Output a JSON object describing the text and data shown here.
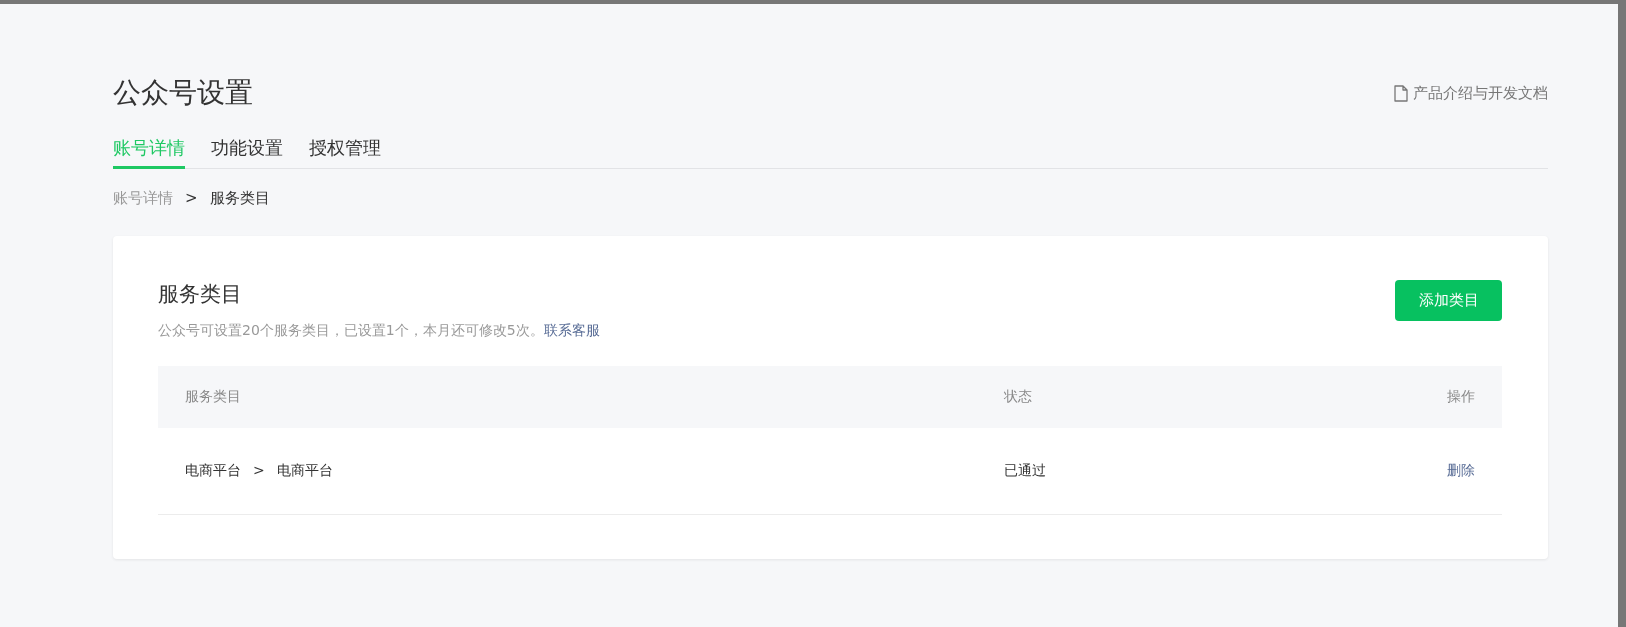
{
  "page_title": "公众号设置",
  "doc_link": {
    "label": "产品介绍与开发文档"
  },
  "tabs": [
    {
      "label": "账号详情",
      "selected": true
    },
    {
      "label": "功能设置",
      "selected": false
    },
    {
      "label": "授权管理",
      "selected": false
    }
  ],
  "breadcrumb": [
    {
      "label": "账号详情",
      "current": false
    },
    {
      "label": "服务类目",
      "current": true
    }
  ],
  "breadcrumb_separator": ">",
  "card": {
    "title": "服务类目",
    "description": "公众号可设置20个服务类目，已设置1个，本月还可修改5次。",
    "contact_link": "联系客服",
    "add_button": "添加类目"
  },
  "table": {
    "columns": [
      "服务类目",
      "状态",
      "操作"
    ],
    "rows": [
      {
        "category": [
          "电商平台",
          "电商平台"
        ],
        "separator": ">",
        "status": "已通过",
        "action": "删除"
      }
    ]
  }
}
